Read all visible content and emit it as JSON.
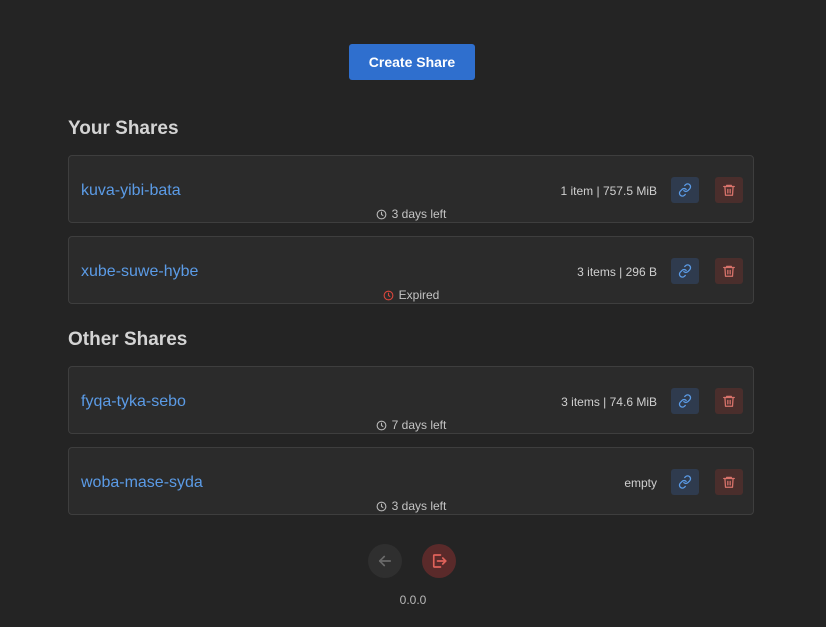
{
  "create_share_label": "Create Share",
  "your_shares": {
    "title": "Your Shares",
    "items": [
      {
        "name": "kuva-yibi-bata",
        "meta": "1 item | 757.5 MiB",
        "status": "3 days left",
        "status_icon": "clock-icon"
      },
      {
        "name": "xube-suwe-hybe",
        "meta": "3 items | 296 B",
        "status": "Expired",
        "status_icon": "expired-clock-icon"
      }
    ]
  },
  "other_shares": {
    "title": "Other Shares",
    "items": [
      {
        "name": "fyqa-tyka-sebo",
        "meta": "3 items | 74.6 MiB",
        "status": "7 days left",
        "status_icon": "clock-icon"
      },
      {
        "name": "woba-mase-syda",
        "meta": "empty",
        "status": "3 days left",
        "status_icon": "clock-icon"
      }
    ]
  },
  "footer": {
    "version": "0.0.0"
  },
  "colors": {
    "accent": "#2f6fce",
    "link": "#5b9be6",
    "expired": "#d9453b",
    "delete": "#d9736b"
  }
}
